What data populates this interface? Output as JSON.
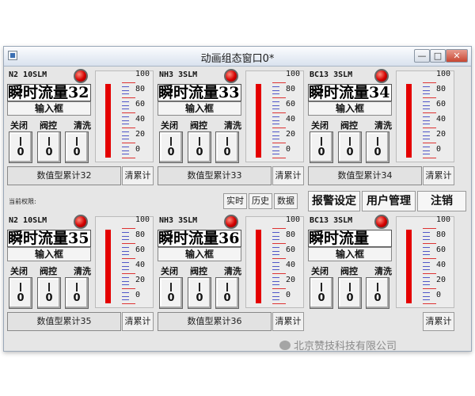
{
  "window": {
    "title": "动画组态窗口0*",
    "min_label": "—",
    "max_label": "□",
    "close_label": "✕"
  },
  "panels": [
    {
      "sensor": "N2  10SLM",
      "flow_text": "瞬时流量32",
      "input_label": "输入框",
      "ops": [
        "关闭",
        "阀控",
        "清洗"
      ],
      "switch_values": [
        "0",
        "0",
        "0"
      ],
      "gauge_ticks": [
        "100",
        "80",
        "60",
        "40",
        "20",
        "0"
      ],
      "level": 0.98,
      "accum_label": "数值型累计32",
      "clear_label": "清累计"
    },
    {
      "sensor": "NH3  3SLM",
      "flow_text": "瞬时流量33",
      "input_label": "输入框",
      "ops": [
        "关闭",
        "阀控",
        "清洗"
      ],
      "switch_values": [
        "0",
        "0",
        "0"
      ],
      "gauge_ticks": [
        "100",
        "80",
        "60",
        "40",
        "20",
        "0"
      ],
      "level": 0.98,
      "accum_label": "数值型累计33",
      "clear_label": "清累计"
    },
    {
      "sensor": "BC13  3SLM",
      "flow_text": "瞬时流量34",
      "input_label": "输入框",
      "ops": [
        "关闭",
        "阀控",
        "清洗"
      ],
      "switch_values": [
        "0",
        "0",
        "0"
      ],
      "gauge_ticks": [
        "100",
        "80",
        "60",
        "40",
        "20",
        "0"
      ],
      "level": 0.98,
      "accum_label": "数值型累计34",
      "clear_label": "清累计"
    },
    {
      "sensor": "N2  10SLM",
      "flow_text": "瞬时流量35",
      "input_label": "输入框",
      "ops": [
        "关闭",
        "阀控",
        "清洗"
      ],
      "switch_values": [
        "0",
        "0",
        "0"
      ],
      "gauge_ticks": [
        "100",
        "80",
        "60",
        "40",
        "20",
        "0"
      ],
      "level": 0.98,
      "accum_label": "数值型累计35",
      "clear_label": "清累计"
    },
    {
      "sensor": "NH3  3SLM",
      "flow_text": "瞬时流量36",
      "input_label": "输入框",
      "ops": [
        "关闭",
        "阀控",
        "清洗"
      ],
      "switch_values": [
        "0",
        "0",
        "0"
      ],
      "gauge_ticks": [
        "100",
        "80",
        "60",
        "40",
        "20",
        "0"
      ],
      "level": 0.98,
      "accum_label": "数值型累计36",
      "clear_label": "清累计"
    },
    {
      "sensor": "BC13  3SLM",
      "flow_text": "瞬时流量",
      "input_label": "输入框",
      "ops": [
        "关闭",
        "阀控",
        "清洗"
      ],
      "switch_values": [
        "0",
        "0",
        "0"
      ],
      "gauge_ticks": [
        "100",
        "80",
        "60",
        "40",
        "20",
        "0"
      ],
      "level": 0.98,
      "accum_label": "",
      "clear_label": "清累计"
    }
  ],
  "toolbar": {
    "permission_label": "当前权限:",
    "realtime": "实时",
    "history": "历史",
    "data": "数据",
    "alarm_settings": "报警设定",
    "user_mgmt": "用户管理",
    "logout": "注销"
  },
  "watermark": "北京赞技科技有限公司",
  "colors": {
    "gauge_fill": "#e40000",
    "led": "#d40000"
  }
}
